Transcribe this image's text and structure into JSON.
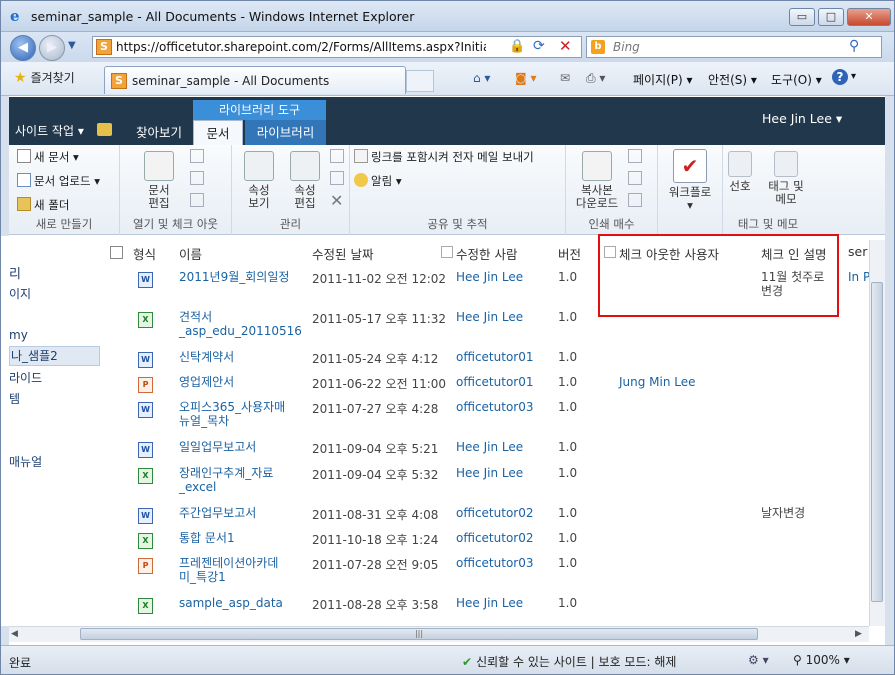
{
  "window": {
    "title": "seminar_sample - All Documents - Windows Internet Explorer",
    "buttons": {
      "minimize": "▭",
      "maximize": "□",
      "close": "✕"
    }
  },
  "browser": {
    "url": "https://officetutor.sharepoint.com/2/Forms/AllItems.aspx?InitialTabIc",
    "search_placeholder": "Bing",
    "favorites_label": "즐겨찾기",
    "tab_title": "seminar_sample - All Documents",
    "commands": {
      "page": "페이지(P) ▾",
      "safety": "안전(S) ▾",
      "tools": "도구(O) ▾",
      "help": "?"
    }
  },
  "sharepoint": {
    "site_actions": "사이트 작업 ▾",
    "user": "Hee Jin Lee ▾",
    "library_tools": "라이브러리 도구",
    "tabs": {
      "browse": "찾아보기",
      "documents": "문서",
      "library": "라이브러리"
    }
  },
  "ribbon": {
    "new_group": {
      "label": "새로 만들기",
      "new_document": "새 문서 ▾",
      "upload_document": "문서 업로드 ▾",
      "new_folder": "새 폴더"
    },
    "open_checkout_group": {
      "label": "열기 및 체크 아웃",
      "edit_document": "문서\n편집"
    },
    "manage_group": {
      "label": "관리",
      "view_properties": "속성\n보기",
      "edit_properties": "속성\n편집"
    },
    "share_track_group": {
      "label": "공유 및 추적",
      "email_link": "링크를 포함시켜 전자 메일 보내기",
      "alert_me": "알림 ▾"
    },
    "copies_group": {
      "label": "인쇄 매수",
      "download_copy": "복사본\n다운로드"
    },
    "workflows_group": {
      "workflows": "워크플로\n▾"
    },
    "tags_group": {
      "label": "태그 및 메모",
      "i_like_it": "선호",
      "tags_notes": "태그 및\n메모"
    }
  },
  "left_nav": {
    "items": [
      "리",
      "이지",
      "my",
      "나_샘플2",
      "라이드",
      "템",
      "매뉴얼"
    ]
  },
  "list": {
    "headers": {
      "type": "형식",
      "name": "이름",
      "modified": "수정된 날짜",
      "modified_by": "수정한 사람",
      "version": "버전",
      "checked_out_to": "체크 아웃한 사용자",
      "checkin_comment": "체크 인 설명",
      "extra": "ser"
    },
    "rows": [
      {
        "icon": "W",
        "name": "2011년9월_회의일정",
        "modified": "2011-11-02 오전 12:02",
        "by": "Hee Jin Lee",
        "version": "1.0",
        "checked_out": "",
        "comment": "11월 첫주로\n변경",
        "extra": "In P"
      },
      {
        "icon": "X",
        "name": "견적서\n_asp_edu_20110516",
        "modified": "2011-05-17 오후 11:32",
        "by": "Hee Jin Lee",
        "version": "1.0",
        "checked_out": "",
        "comment": "",
        "extra": ""
      },
      {
        "icon": "W",
        "name": "신탁계약서",
        "modified": "2011-05-24 오후 4:12",
        "by": "officetutor01",
        "version": "1.0",
        "checked_out": "",
        "comment": "",
        "extra": ""
      },
      {
        "icon": "P",
        "name": "영업제안서",
        "modified": "2011-06-22 오전 11:00",
        "by": "officetutor01",
        "version": "1.0",
        "checked_out": "Jung Min Lee",
        "comment": "",
        "extra": ""
      },
      {
        "icon": "W",
        "name": "오피스365_사용자매\n뉴얼_목차",
        "modified": "2011-07-27 오후 4:28",
        "by": "officetutor03",
        "version": "1.0",
        "checked_out": "",
        "comment": "",
        "extra": ""
      },
      {
        "icon": "W",
        "name": "일일업무보고서",
        "modified": "2011-09-04 오후 5:21",
        "by": "Hee Jin Lee",
        "version": "1.0",
        "checked_out": "",
        "comment": "",
        "extra": ""
      },
      {
        "icon": "X",
        "name": "장래인구추계_자료\n_excel",
        "modified": "2011-09-04 오후 5:32",
        "by": "Hee Jin Lee",
        "version": "1.0",
        "checked_out": "",
        "comment": "",
        "extra": ""
      },
      {
        "icon": "W",
        "name": "주간업무보고서",
        "modified": "2011-08-31 오후 4:08",
        "by": "officetutor02",
        "version": "1.0",
        "checked_out": "",
        "comment": "날자변경",
        "extra": ""
      },
      {
        "icon": "X",
        "name": "통합 문서1",
        "modified": "2011-10-18 오후 1:24",
        "by": "officetutor02",
        "version": "1.0",
        "checked_out": "",
        "comment": "",
        "extra": ""
      },
      {
        "icon": "P",
        "name": "프레젠테이션아카데\n미_특강1",
        "modified": "2011-07-28 오전 9:05",
        "by": "officetutor03",
        "version": "1.0",
        "checked_out": "",
        "comment": "",
        "extra": ""
      },
      {
        "icon": "X",
        "name": "sample_asp_data",
        "modified": "2011-08-28 오후 3:58",
        "by": "Hee Jin Lee",
        "version": "1.0",
        "checked_out": "",
        "comment": "",
        "extra": ""
      }
    ]
  },
  "status_bar": {
    "done": "완료",
    "trusted": "신뢰할 수 있는 사이트 | 보호 모드: 해제",
    "zoom": "100%"
  },
  "colors": {
    "link": "#1b62a3",
    "highlight": "#e01010",
    "sp_top": "#21374c",
    "ribbon_active": "#3a8fd8"
  }
}
